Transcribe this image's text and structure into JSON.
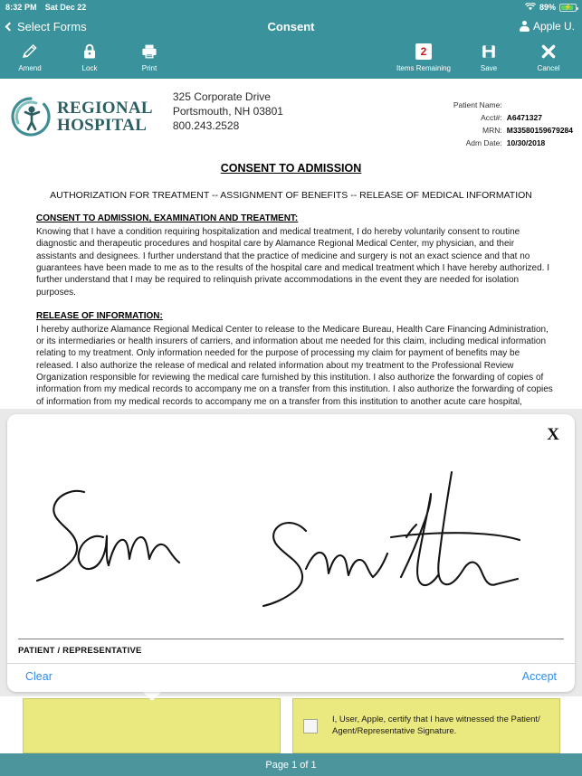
{
  "statusbar": {
    "time": "8:32 PM",
    "date": "Sat Dec 22",
    "battery_percent": "89%",
    "wifi_icon": "wifi-icon",
    "battery_icon": "battery-charging-icon"
  },
  "navbar": {
    "back_label": "Select Forms",
    "title": "Consent",
    "user_label": "Apple U.",
    "back_icon": "chevron-left-icon",
    "user_icon": "person-icon"
  },
  "toolbar": {
    "left_items": [
      {
        "label": "Amend",
        "icon": "pencil-icon"
      },
      {
        "label": "Lock",
        "icon": "lock-icon"
      },
      {
        "label": "Print",
        "icon": "printer-icon"
      }
    ],
    "right_items": [
      {
        "label": "Items Remaining",
        "icon": "badge-count",
        "count": "2"
      },
      {
        "label": "Save",
        "icon": "floppy-disk-icon"
      },
      {
        "label": "Cancel",
        "icon": "close-x-icon"
      }
    ],
    "badge_color": "#d01919"
  },
  "document": {
    "logo": {
      "line1": "REGIONAL",
      "line2": "HOSPITAL",
      "icon": "hospital-circle-person-logo",
      "color": "#2b5f63"
    },
    "address": [
      "325 Corporate Drive",
      "Portsmouth, NH 03801",
      "800.243.2528"
    ],
    "patient_info": [
      {
        "key": "Patient Name:",
        "value": ""
      },
      {
        "key": "Acct#:",
        "value": "A6471327"
      },
      {
        "key": "MRN:",
        "value": "M33580159679284"
      },
      {
        "key": "Adm Date:",
        "value": "10/30/2018"
      }
    ],
    "title": "CONSENT TO ADMISSION",
    "subtitle": "AUTHORIZATION FOR TREATMENT -- ASSIGNMENT OF BENEFITS -- RELEASE OF MEDICAL INFORMATION",
    "section1_heading": "CONSENT TO ADMISSION, EXAMINATION AND TREATMENT:",
    "section1_body": "Knowing that I have a condition requiring hospitalization and medical treatment, I do hereby voluntarily consent to routine diagnostic and therapeutic procedures and hospital care by Alamance Regional Medical Center, my physician, and their assistants and designees. I further understand that the practice of medicine and surgery is not an exact science and that no guarantees have been made to me as to the results of the hospital care and medical treatment which I have hereby authorized. I further understand that I may be required to relinquish private accommodations in the event they are needed for isolation purposes.",
    "section2_heading": "RELEASE OF INFORMATION:",
    "section2_body": "I hereby authorize Alamance Regional Medical Center to release to the Medicare Bureau, Health Care Financing Administration, or its intermediaries or health insurers of carriers, and information about me needed for this claim, including medical information relating to my treatment. Only information needed for the purpose of processing my claim for payment of benefits may be released. I also authorize the release of medical and related information about my treatment to the Professional Review Organization responsible for reviewing the medical care furnished by this institution. I also authorize the forwarding of copies of information from my medical records to accompany me on a transfer from this institution. I also authorize the forwarding of copies of information from my medical records to accompany me on a transfer from this institution to another acute care hospital, intermediate care facility, skilled nursing home or nursing home as ordered by my physician. I authorize the release of copies of my medical record for this visit to my attending physician(s). I further authorize inspection of my medical record by the N.C. Department of Human Resources as specified in GS 130 (e)(1) and other relative legislation to insure this facility's compliance regarding licensure and certification. I have been further advised that I have the right to object in writing to such release and that my objection in writing may prohibit the inspection or release of my"
  },
  "signature_modal": {
    "close_label": "X",
    "caption": "PATIENT / REPRESENTATIVE",
    "clear_label": "Clear",
    "accept_label": "Accept",
    "signature_text": "Sam Smith",
    "link_color": "#2d8cf0"
  },
  "fields": {
    "left_field_value": "",
    "witness_checkbox_checked": false,
    "witness_label": "I, User, Apple, certify that I have witnessed the Patient/ Agent/Representative Signature.",
    "highlight_color": "#eae97f"
  },
  "footer": {
    "page_label": "Page 1 of 1"
  },
  "theme": {
    "teal": "#3a939c",
    "footer_teal": "#4d959c",
    "backdrop_gray": "#e9e9e9"
  }
}
